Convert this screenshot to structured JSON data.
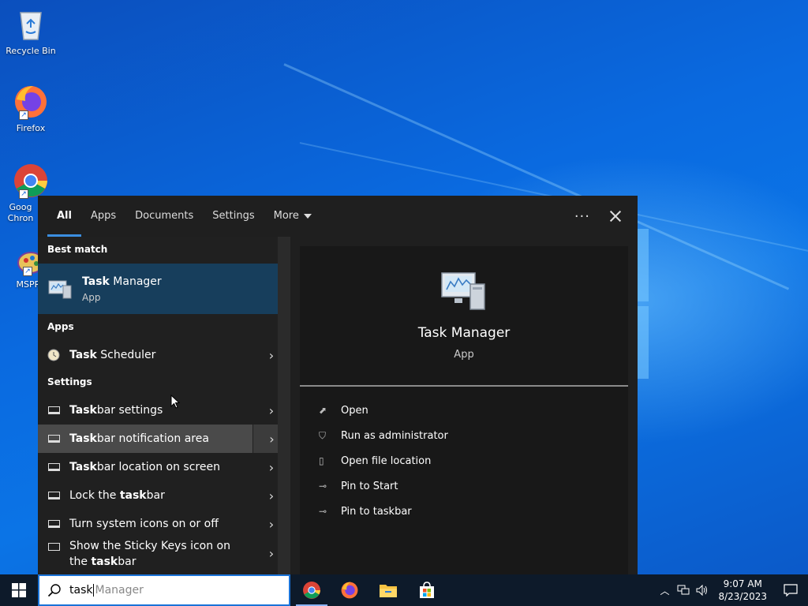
{
  "desktop": {
    "icons": [
      {
        "label": "Recycle Bin"
      },
      {
        "label": "Firefox"
      },
      {
        "label": "Goog Chron"
      },
      {
        "label": "MSPRe"
      }
    ]
  },
  "search": {
    "tabs": [
      "All",
      "Apps",
      "Documents",
      "Settings",
      "More"
    ],
    "active_tab": "All",
    "more_icon": "ellipsis-icon",
    "close_icon": "close-icon",
    "best_match_heading": "Best match",
    "best_match": {
      "title_bold": "Task",
      "title_rest": " Manager",
      "subtitle": "App"
    },
    "apps_heading": "Apps",
    "apps": [
      {
        "bold": "Task",
        "rest": " Scheduler"
      }
    ],
    "settings_heading": "Settings",
    "settings": [
      {
        "pre": "",
        "bold": "Task",
        "post": "bar settings"
      },
      {
        "pre": "",
        "bold": "Task",
        "post": "bar notification area"
      },
      {
        "pre": "",
        "bold": "Task",
        "post": "bar location on screen"
      },
      {
        "pre": "Lock the ",
        "bold": "task",
        "post": "bar"
      },
      {
        "pre": "Turn system icons on or off",
        "bold": "",
        "post": ""
      },
      {
        "pre": "Show the Sticky Keys icon on the ",
        "bold": "task",
        "post": "bar"
      }
    ],
    "detail": {
      "name": "Task Manager",
      "type": "App"
    },
    "actions": [
      "Open",
      "Run as administrator",
      "Open file location",
      "Pin to Start",
      "Pin to taskbar"
    ]
  },
  "taskbar": {
    "search_typed": "task",
    "search_suggestion": "Manager",
    "time": "9:07 AM",
    "date": "8/23/2023"
  }
}
